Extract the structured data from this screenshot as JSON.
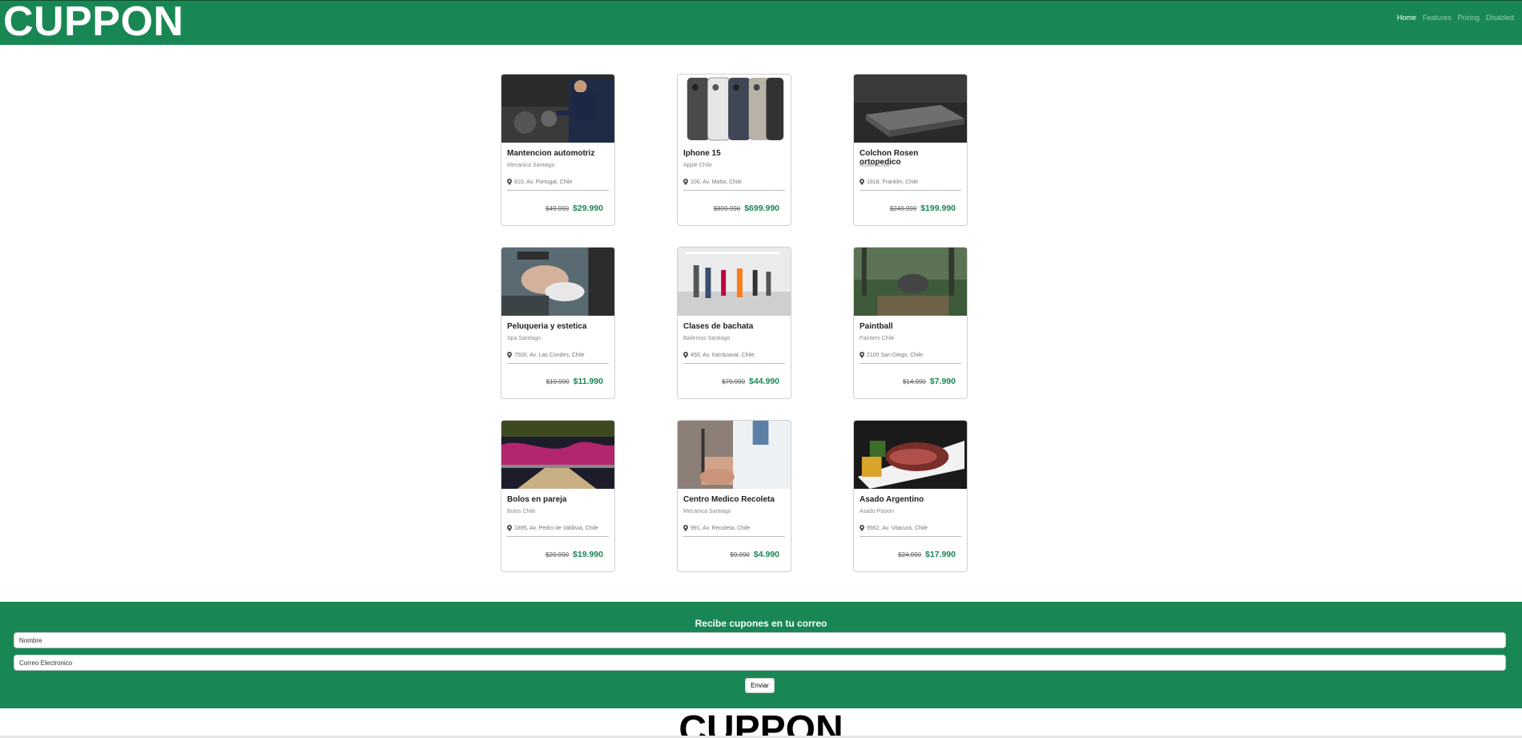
{
  "nav": {
    "brand": "CUPPON",
    "links": [
      "Home",
      "Features",
      "Pricing",
      "Disabled"
    ]
  },
  "cards": [
    {
      "title": "Mantencion automotriz",
      "company": "Mecanica Santiago",
      "address": "810, Av. Portugal, Chile",
      "old_price": "$49.990",
      "new_price": "$29.990",
      "image": "mechanic-photo"
    },
    {
      "title": "Iphone 15",
      "company": "Apple Chile",
      "address": "100, Av. Matta, Chile",
      "old_price": "$899.990",
      "new_price": "$699.990",
      "image": "iphone-photo"
    },
    {
      "title": "Colchon Rosen ortopedico",
      "company": "Rosen Chile",
      "address": "1818, Franklin, Chile",
      "old_price": "$249.990",
      "new_price": "$199.990",
      "image": "mattress-photo"
    },
    {
      "title": "Peluqueria y estetica",
      "company": "Spa Santiago",
      "address": "7500, Av. Las Condes, Chile",
      "old_price": "$19.990",
      "new_price": "$11.990",
      "image": "hair-salon-photo"
    },
    {
      "title": "Clases de bachata",
      "company": "Bailemos Santiago",
      "address": "450, Av. Irarrázaval, Chile",
      "old_price": "$79.990",
      "new_price": "$44.990",
      "image": "dance-class-photo"
    },
    {
      "title": "Paintball",
      "company": "Painters Chile",
      "address": "2100 San Diego, Chile",
      "old_price": "$14.990",
      "new_price": "$7.990",
      "image": "paintball-photo"
    },
    {
      "title": "Bolos en pareja",
      "company": "Bolos Chile",
      "address": "1895, Av. Pedro de Valdivia, Chile",
      "old_price": "$29.990",
      "new_price": "$19.990",
      "image": "bowling-photo"
    },
    {
      "title": "Centro Medico Recoleta",
      "company": "Mecanica Santiago",
      "address": "991, Av. Recoleta, Chile",
      "old_price": "$9.990",
      "new_price": "$4.990",
      "image": "doctor-photo"
    },
    {
      "title": "Asado Argentino",
      "company": "Asado Pasion",
      "address": "9562, Av. Vitacura, Chile",
      "old_price": "$24.990",
      "new_price": "$17.990",
      "image": "steak-photo"
    }
  ],
  "newsletter": {
    "title": "Recibe cupones en tu correo",
    "name_placeholder": "Nombre",
    "email_placeholder": "Correo Electronico",
    "submit_label": "Enviar"
  },
  "footer": {
    "brand": "CUPPON"
  },
  "colors": {
    "brand_green": "#198754",
    "price_green": "#198754"
  }
}
